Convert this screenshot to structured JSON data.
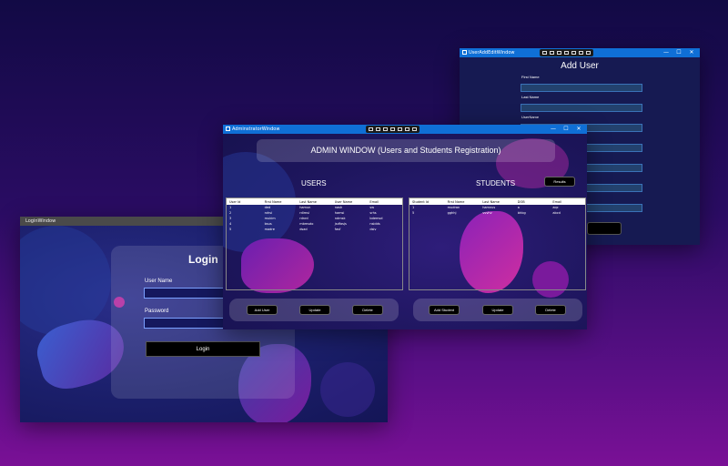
{
  "login_window": {
    "title": "LoginWindow",
    "heading": "Login",
    "username_label": "User Name",
    "password_label": "Password",
    "login_button": "Login"
  },
  "adduser_window": {
    "title": "UserAddEditWindow",
    "heading": "Add User",
    "labels": [
      "First Name",
      "Last Name",
      "UserName"
    ]
  },
  "admin_window": {
    "title": "AdminstratorWindow",
    "header": "ADMIN WINDOW (Users and Students Registration)",
    "users_title": "USERS",
    "students_title": "STUDENTS",
    "results_button": "Results",
    "users_table": {
      "columns": [
        "User Id",
        "First Name",
        "Last Name",
        "User Name",
        "Email"
      ],
      "rows": [
        [
          "1",
          "ded",
          "hamun",
          "nash",
          "sw"
        ],
        [
          "2",
          "rxhsi",
          "rdimsi",
          "hamsi",
          "srhs"
        ],
        [
          "3",
          "mukim",
          "rdnrd",
          "ndmsk",
          "bdemsd"
        ],
        [
          "4",
          "bsus",
          "mbmsdo",
          "jsdfasjs",
          "nsidds"
        ],
        [
          "5",
          "madre",
          "dsad",
          "fasf",
          "dsiv"
        ]
      ]
    },
    "students_table": {
      "columns": [
        "Student Id",
        "First Name",
        "Last Name",
        "DOB",
        "Email"
      ],
      "rows": [
        [
          "1",
          "mudran",
          "hamnus",
          "a",
          "aqc"
        ],
        [
          "5",
          "gghhj",
          "vvvhv",
          "bhbg",
          "abcd"
        ]
      ]
    },
    "user_buttons": [
      "Add User",
      "Update",
      "Delete"
    ],
    "student_buttons": [
      "Add Student",
      "Update",
      "Delete"
    ]
  },
  "window_controls": [
    "—",
    "☐",
    "✕"
  ],
  "colors": {
    "accent": "#0f6fd6",
    "magenta": "#c02aa8"
  }
}
